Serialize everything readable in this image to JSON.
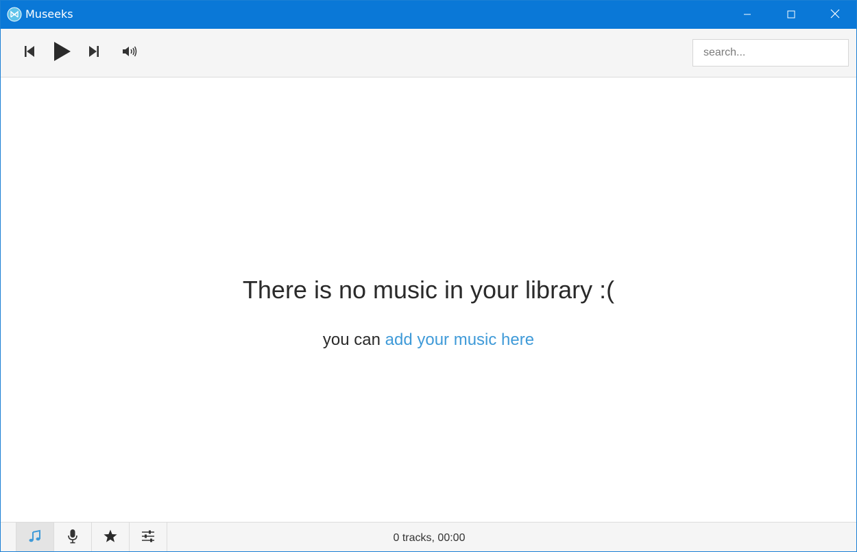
{
  "window": {
    "title": "Museeks",
    "icons": {
      "app": "museeks-logo-icon",
      "minimize": "minimize-icon",
      "maximize": "maximize-icon",
      "close": "close-icon"
    },
    "colors": {
      "titlebar": "#0a78d7",
      "accent": "#3f9ad8"
    }
  },
  "toolbar": {
    "controls": [
      {
        "name": "previous",
        "icon": "skip-previous-icon"
      },
      {
        "name": "play",
        "icon": "play-icon"
      },
      {
        "name": "next",
        "icon": "skip-next-icon"
      },
      {
        "name": "volume",
        "icon": "volume-icon"
      }
    ],
    "search": {
      "placeholder": "search...",
      "value": ""
    }
  },
  "main": {
    "empty_title": "There is no music in your library :(",
    "empty_prefix": "you can ",
    "empty_link": "add your music here"
  },
  "footer": {
    "nav": [
      {
        "name": "library",
        "icon": "music-note-icon",
        "active": true
      },
      {
        "name": "playlists",
        "icon": "microphone-icon",
        "active": false
      },
      {
        "name": "favorites",
        "icon": "star-icon",
        "active": false
      },
      {
        "name": "settings",
        "icon": "settings-sliders-icon",
        "active": false
      }
    ],
    "status": "0 tracks, 00:00"
  }
}
